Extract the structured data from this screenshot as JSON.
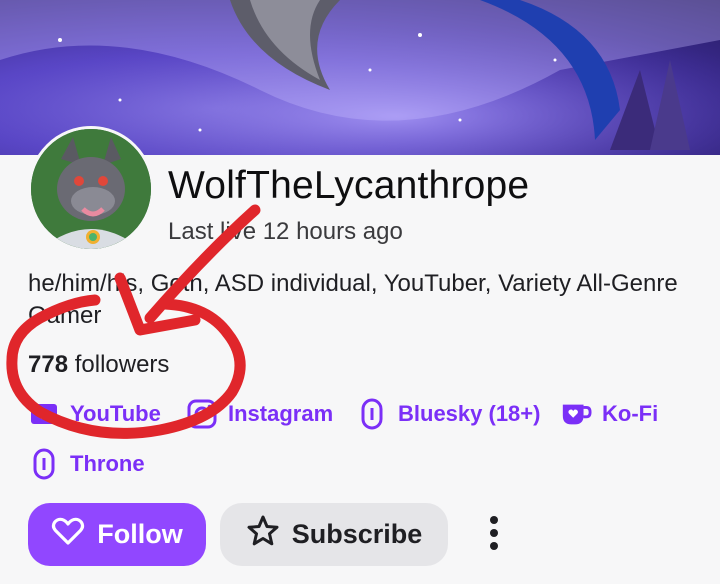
{
  "channel": {
    "name": "WolfTheLycanthrope",
    "last_live": "Last live 12 hours ago",
    "bio": "he/him/his, Goth, ASD individual, YouTuber, Variety All-Genre Gamer",
    "followers_count": "778",
    "followers_label": "followers"
  },
  "social_links": [
    {
      "label": "YouTube",
      "icon": "youtube-icon"
    },
    {
      "label": "Instagram",
      "icon": "instagram-icon"
    },
    {
      "label": "Bluesky (18+)",
      "icon": "link-icon"
    },
    {
      "label": "Ko-Fi",
      "icon": "kofi-icon"
    },
    {
      "label": "Throne",
      "icon": "link-icon"
    }
  ],
  "actions": {
    "follow_label": "Follow",
    "subscribe_label": "Subscribe"
  },
  "colors": {
    "accent": "#9147ff",
    "link": "#7b2ff7",
    "annotation": "#e0262b"
  }
}
